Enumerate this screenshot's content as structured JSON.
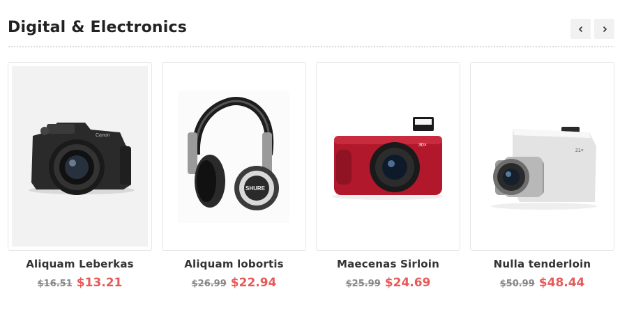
{
  "section": {
    "title": "Digital & Electronics"
  },
  "products": [
    {
      "name": "Aliquam Leberkas",
      "old_price": "$16.51",
      "new_price": "$13.21"
    },
    {
      "name": "Aliquam lobortis",
      "old_price": "$26.99",
      "new_price": "$22.94"
    },
    {
      "name": "Maecenas Sirloin",
      "old_price": "$25.99",
      "new_price": "$24.69"
    },
    {
      "name": "Nulla tenderloin",
      "old_price": "$50.99",
      "new_price": "$48.44"
    }
  ],
  "colors": {
    "sale_price": "#e65a5a",
    "old_price": "#888888",
    "nav_bg": "#f1f1f1"
  },
  "icons": {
    "prev": "chevron-left-icon",
    "next": "chevron-right-icon"
  }
}
